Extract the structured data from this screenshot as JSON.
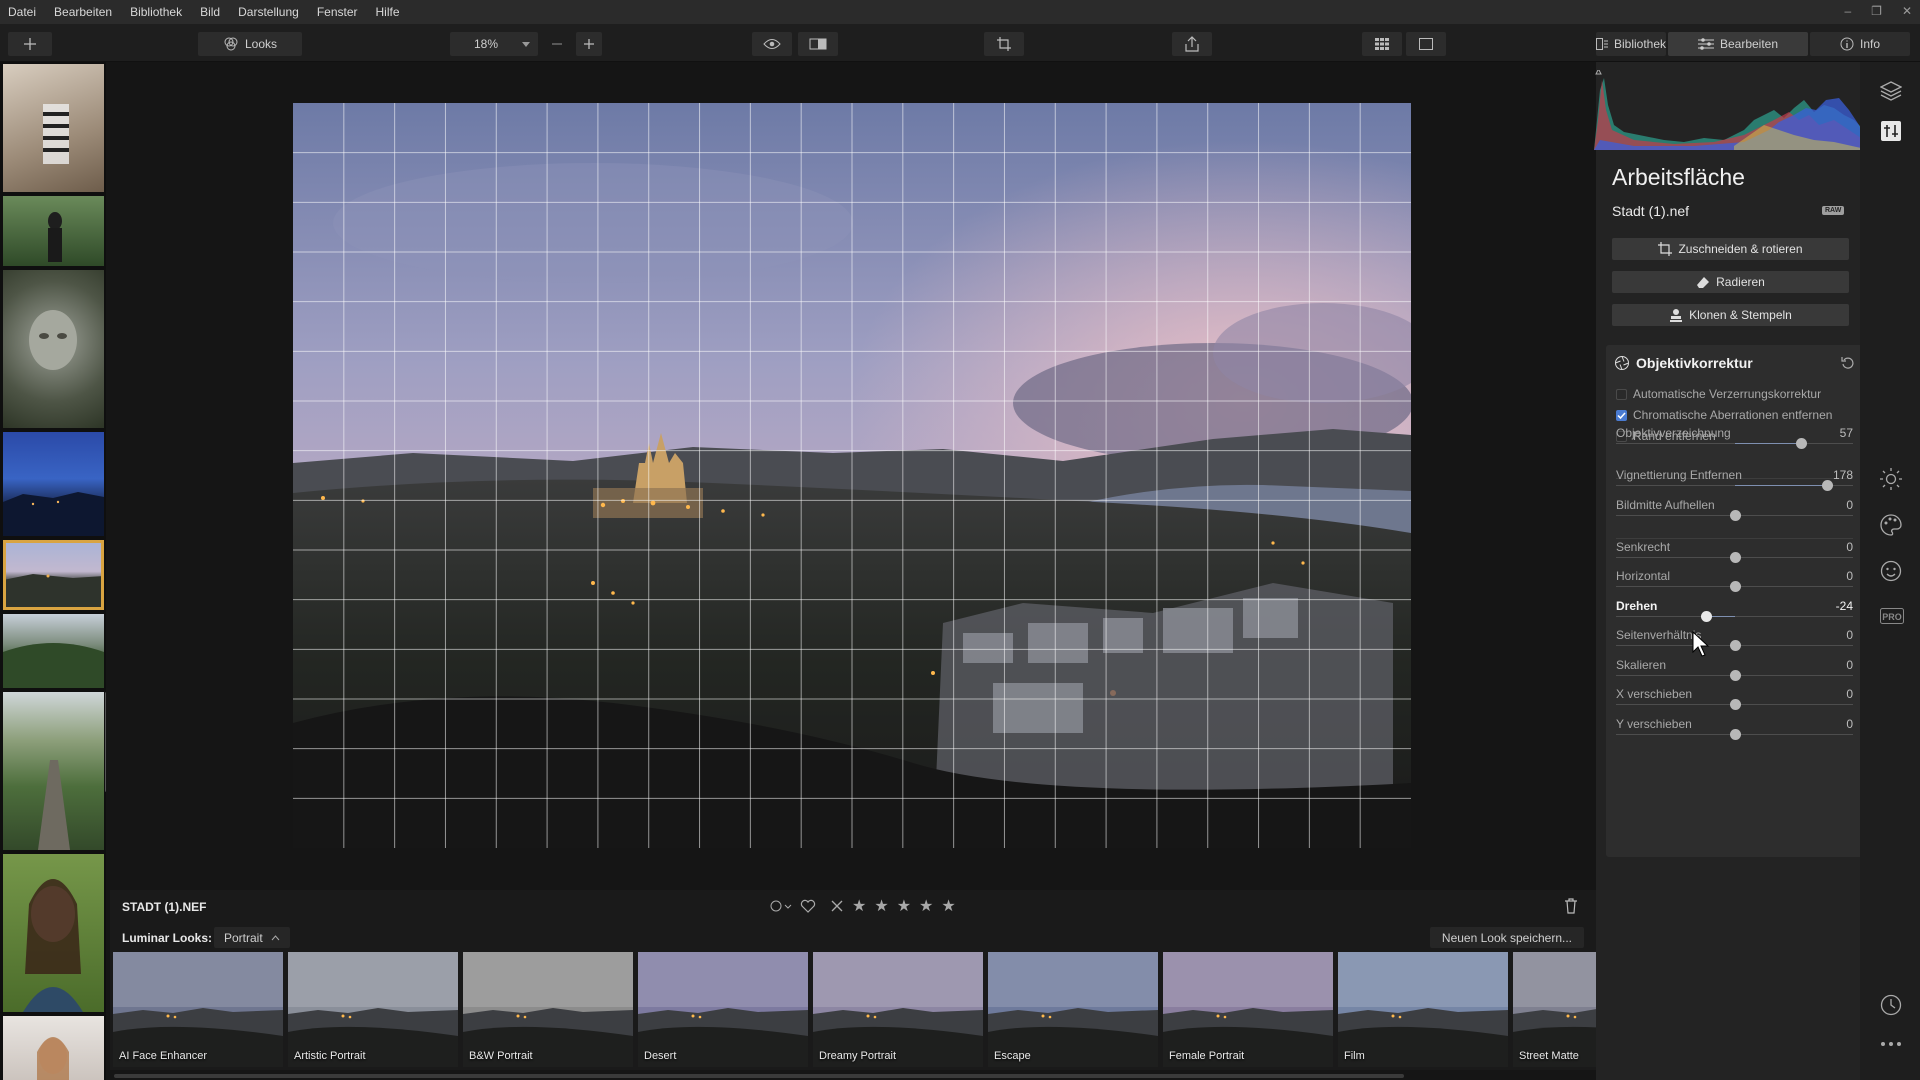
{
  "menu": {
    "items": [
      "Datei",
      "Bearbeiten",
      "Bibliothek",
      "Bild",
      "Darstellung",
      "Fenster",
      "Hilfe"
    ]
  },
  "toolbar": {
    "looks_label": "Looks",
    "zoom_value": "18%",
    "tab_library": "Bibliothek",
    "tab_edit": "Bearbeiten",
    "tab_info": "Info"
  },
  "editor": {
    "panel_title": "Arbeitsfläche",
    "file_name": "Stadt (1).nef",
    "raw_badge": "RAW",
    "tools": {
      "crop": "Zuschneiden & rotieren",
      "erase": "Radieren",
      "clone": "Klonen & Stempeln"
    }
  },
  "lens_correction": {
    "title": "Objektivkorrektur",
    "checkboxes": [
      {
        "label": "Automatische Verzerrungskorrektur",
        "checked": false
      },
      {
        "label": "Chromatische Aberrationen entfernen",
        "checked": true
      },
      {
        "label": "Rand entfernen",
        "checked": false
      }
    ],
    "sliders": [
      {
        "label": "Objektivverzeichnung",
        "value": "57",
        "level": 0.78,
        "fill_from": 0.5
      },
      {
        "label": "Vignettierung Entfernen",
        "value": "178",
        "level": 0.89,
        "fill_from": 0.5
      },
      {
        "label": "Bildmitte Aufhellen",
        "value": "0",
        "level": 0.5,
        "fill_from": 0.5
      },
      {
        "label": "Senkrecht",
        "value": "0",
        "level": 0.5,
        "fill_from": 0.5
      },
      {
        "label": "Horizontal",
        "value": "0",
        "level": 0.5,
        "fill_from": 0.5
      },
      {
        "label": "Drehen",
        "value": "-24",
        "level": 0.38,
        "fill_from": 0.5,
        "active": true
      },
      {
        "label": "Seitenverhältnis",
        "value": "0",
        "level": 0.5,
        "fill_from": 0.5
      },
      {
        "label": "Skalieren",
        "value": "0",
        "level": 0.5,
        "fill_from": 0.5
      },
      {
        "label": "X verschieben",
        "value": "0",
        "level": 0.5,
        "fill_from": 0.5
      },
      {
        "label": "Y verschieben",
        "value": "0",
        "level": 0.5,
        "fill_from": 0.5
      }
    ]
  },
  "image_info": {
    "filename_upper": "STADT (1).NEF",
    "rating_stars": 0
  },
  "looks": {
    "label": "Luminar Looks:",
    "category": "Portrait",
    "save_button": "Neuen Look speichern...",
    "items": [
      {
        "name": "AI Face Enhancer",
        "tone": "#6f7690"
      },
      {
        "name": "Artistic Portrait",
        "tone": "#8a8f9a"
      },
      {
        "name": "B&W Portrait",
        "tone": "#8c8c8c"
      },
      {
        "name": "Desert",
        "tone": "#7d7aa0"
      },
      {
        "name": "Dreamy Portrait",
        "tone": "#8d86a3"
      },
      {
        "name": "Escape",
        "tone": "#6e7a9c"
      },
      {
        "name": "Female Portrait",
        "tone": "#8a7e9f"
      },
      {
        "name": "Film",
        "tone": "#7686a6"
      },
      {
        "name": "Street Matte",
        "tone": "#7f8090"
      }
    ]
  },
  "colors": {
    "accent": "#4a7bd1",
    "selection": "#d9a441"
  }
}
